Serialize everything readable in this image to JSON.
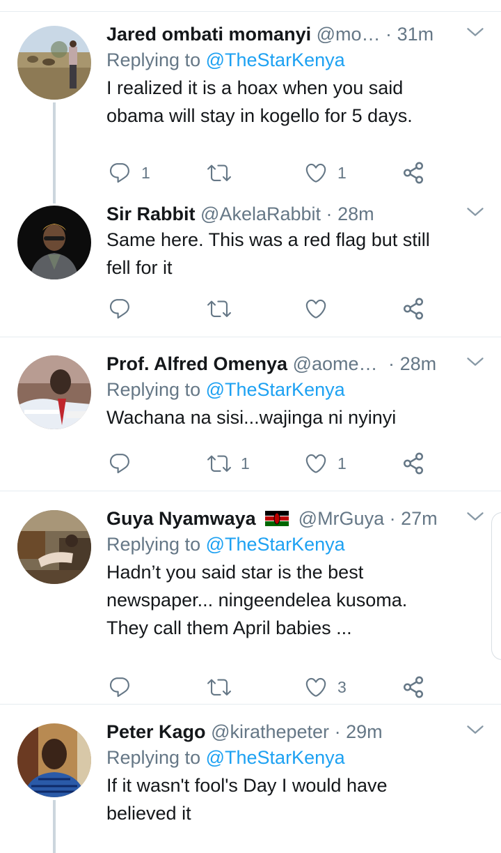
{
  "tweets": [
    {
      "name": "Jared ombati momanyi",
      "handle": "@mo…",
      "time": "31m",
      "replying_prefix": "Replying to",
      "replying_to": "@TheStarKenya",
      "text_lines": [
        "I realized it is a hoax when you said",
        "obama will stay in kogello for 5 days."
      ],
      "reply_count": "1",
      "retweet_count": "",
      "like_count": "1"
    },
    {
      "name": "Sir Rabbit",
      "handle": "@AkelaRabbit",
      "time": "28m",
      "text_lines": [
        "Same here. This was a red flag but still",
        "fell for it"
      ],
      "reply_count": "",
      "retweet_count": "",
      "like_count": ""
    },
    {
      "name": "Prof. Alfred Omenya",
      "handle": "@aome…",
      "time": "28m",
      "replying_prefix": "Replying to",
      "replying_to": "@TheStarKenya",
      "text_lines": [
        "Wachana na sisi...wajinga ni nyinyi"
      ],
      "reply_count": "",
      "retweet_count": "1",
      "like_count": "1"
    },
    {
      "name": "Guya Nyamwaya",
      "handle": "@MrGuya",
      "time": "27m",
      "replying_prefix": "Replying to",
      "replying_to": "@TheStarKenya",
      "text_lines": [
        "Hadn’t you said star is the best",
        "newspaper... ningeendelea kusoma.",
        "They call them April babies ..."
      ],
      "reply_count": "",
      "retweet_count": "",
      "like_count": "3"
    },
    {
      "name": "Peter Kago",
      "handle": "@kirathepeter",
      "time": "29m",
      "replying_prefix": "Replying to",
      "replying_to": "@TheStarKenya",
      "text_lines": [
        "If it wasn't fool's Day I would have",
        "believed it"
      ]
    }
  ],
  "separator": "·",
  "icons": {
    "reply": "reply-icon",
    "retweet": "retweet-icon",
    "like": "like-icon",
    "share": "share-icon",
    "more": "chevron-down-icon",
    "flag": "kenya-flag-icon"
  },
  "colors": {
    "name": "#14171a",
    "secondary": "#657786",
    "mention": "#1da1f2",
    "divider": "#e6ecf0",
    "thread_line": "#ccd6dd"
  }
}
